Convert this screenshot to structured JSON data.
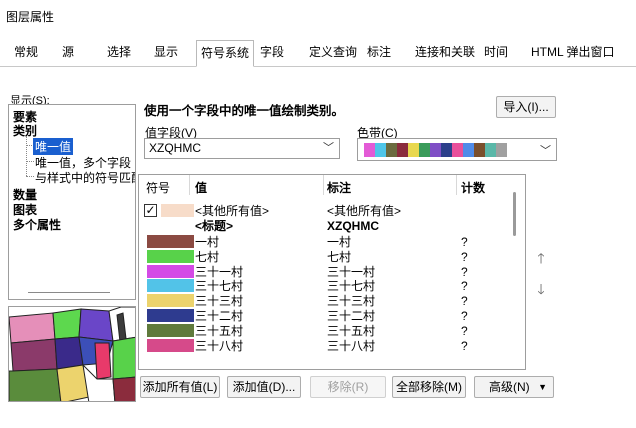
{
  "window": {
    "title": "图层属性"
  },
  "tabs": [
    {
      "label": "常规"
    },
    {
      "label": "源"
    },
    {
      "label": "选择"
    },
    {
      "label": "显示"
    },
    {
      "label": "符号系统"
    },
    {
      "label": "字段"
    },
    {
      "label": "定义查询"
    },
    {
      "label": "标注"
    },
    {
      "label": "连接和关联"
    },
    {
      "label": "时间"
    },
    {
      "label": "HTML 弹出窗口"
    }
  ],
  "show_panel": {
    "label": "显示(S):",
    "items": {
      "features": "要素",
      "categories": "类别",
      "unique_values": "唯一值",
      "unique_values_many": "唯一值，多个字段",
      "match_style": "与样式中的符号匹配",
      "quantities": "数量",
      "charts": "图表",
      "multiple_attributes": "多个属性"
    }
  },
  "description": "使用一个字段中的唯一值绘制类别。",
  "import_button": "导入(I)...",
  "value_field": {
    "label": "值字段(V)",
    "value": "XZQHMC"
  },
  "color_ramp": {
    "label": "色带(C)",
    "colors": [
      "#e35bd6",
      "#4fc6e8",
      "#6b6b3f",
      "#8b2c3d",
      "#e8d84f",
      "#3a9b5a",
      "#7f4fc6",
      "#2c3f8b",
      "#e84f9b",
      "#4f8be8",
      "#7a4f2c",
      "#5ab7a8",
      "#a0a0a0"
    ]
  },
  "table": {
    "headers": {
      "symbol": "符号",
      "value": "值",
      "label": "标注",
      "count": "计数"
    },
    "other_values": {
      "value": "<其他所有值>",
      "label": "<其他所有值>",
      "color": "#f7dcc9"
    },
    "heading_row": {
      "value": "<标题>",
      "label": "XZQHMC"
    },
    "rows": [
      {
        "color": "#8b4a42",
        "value": "一村",
        "label": "一村",
        "count": "?"
      },
      {
        "color": "#58d24a",
        "value": "七村",
        "label": "七村",
        "count": "?"
      },
      {
        "color": "#d44ae6",
        "value": "三十一村",
        "label": "三十一村",
        "count": "?"
      },
      {
        "color": "#52c3e8",
        "value": "三十七村",
        "label": "三十七村",
        "count": "?"
      },
      {
        "color": "#ecd36d",
        "value": "三十三村",
        "label": "三十三村",
        "count": "?"
      },
      {
        "color": "#2e3b8f",
        "value": "三十二村",
        "label": "三十二村",
        "count": "?"
      },
      {
        "color": "#5f7a3c",
        "value": "三十五村",
        "label": "三十五村",
        "count": "?"
      },
      {
        "color": "#d64a8a",
        "value": "三十八村",
        "label": "三十八村",
        "count": "?"
      }
    ]
  },
  "buttons": {
    "add_all": "添加所有值(L)",
    "add_values": "添加值(D)...",
    "remove": "移除(R)",
    "remove_all": "全部移除(M)",
    "advanced": "高级(N)"
  }
}
